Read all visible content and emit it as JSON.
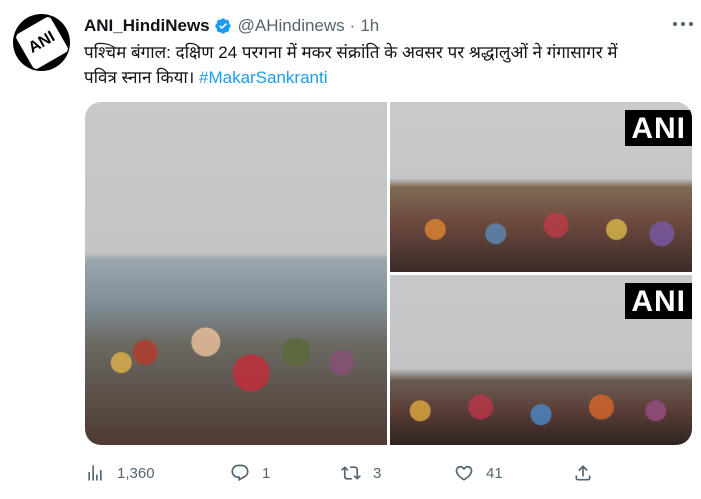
{
  "tweet": {
    "avatar_text": "ANI",
    "display_name": "ANI_HindiNews",
    "handle": "@AHindinews",
    "separator": "·",
    "time": "1h",
    "text_line1": "पश्चिम बंगाल: दक्षिण 24 परगना में मकर संक्रांति के अवसर पर श्रद्धालुओं ने गंगासागर में",
    "text_line2": "पवित्र स्नान किया। ",
    "hashtag": "#MakarSankranti"
  },
  "media": {
    "watermark_2": "ANI",
    "watermark_3": "ANI"
  },
  "actions": {
    "views_count": "1,360",
    "reply_count": "1",
    "retweet_count": "3",
    "like_count": "41"
  },
  "colors": {
    "accent": "#1d9bf0",
    "muted": "#536471",
    "text": "#0f1419"
  },
  "icons": [
    "verified-badge-icon",
    "more-icon",
    "views-icon",
    "reply-icon",
    "retweet-icon",
    "like-icon",
    "share-icon"
  ]
}
